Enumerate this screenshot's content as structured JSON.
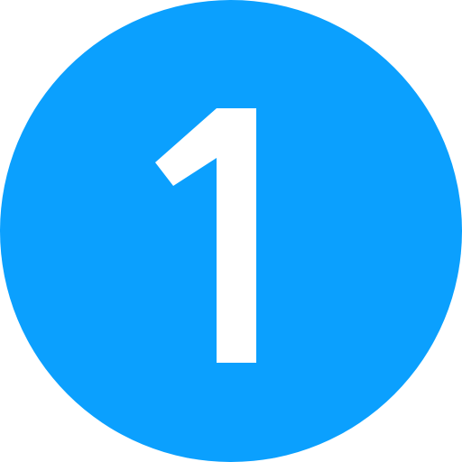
{
  "badge": {
    "number": "1",
    "background_color": "#0ba0fe",
    "text_color": "#ffffff",
    "icon": "number-one-circle-icon"
  }
}
